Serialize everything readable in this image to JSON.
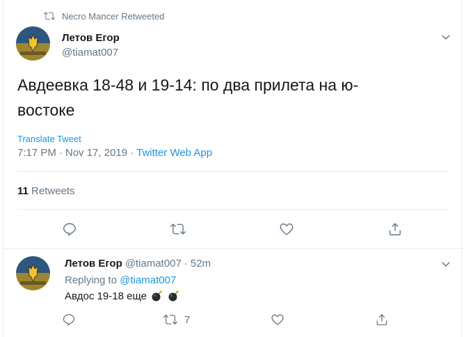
{
  "retweet_header": {
    "text": "Necro Mancer Retweeted",
    "icon": "retweet-icon"
  },
  "tweet": {
    "author_name": "Летов Егор",
    "author_handle": "@tiamat007",
    "text": "Авдеевка 18-48 и 19-14: по два прилета на ю-востоке",
    "translate_label": "Translate Tweet",
    "time": "7:17 PM",
    "separator": "·",
    "date": "Nov 17, 2019",
    "client": "Twitter Web App",
    "retweet_count": "11",
    "retweet_label": "Retweets"
  },
  "reply": {
    "author_name": "Летов Егор",
    "author_handle": "@tiamat007",
    "separator": "·",
    "age": "52m",
    "replying_prefix": "Replying to",
    "replying_to": "@tiamat007",
    "text": "Авдос 19-18 еще",
    "emojis": [
      "bomb-icon",
      "bomb-icon"
    ],
    "retweet_count": "7"
  },
  "colors": {
    "link": "#1b95e0",
    "secondary": "#657786",
    "primary": "#14171a",
    "border": "#e6ecf0"
  }
}
